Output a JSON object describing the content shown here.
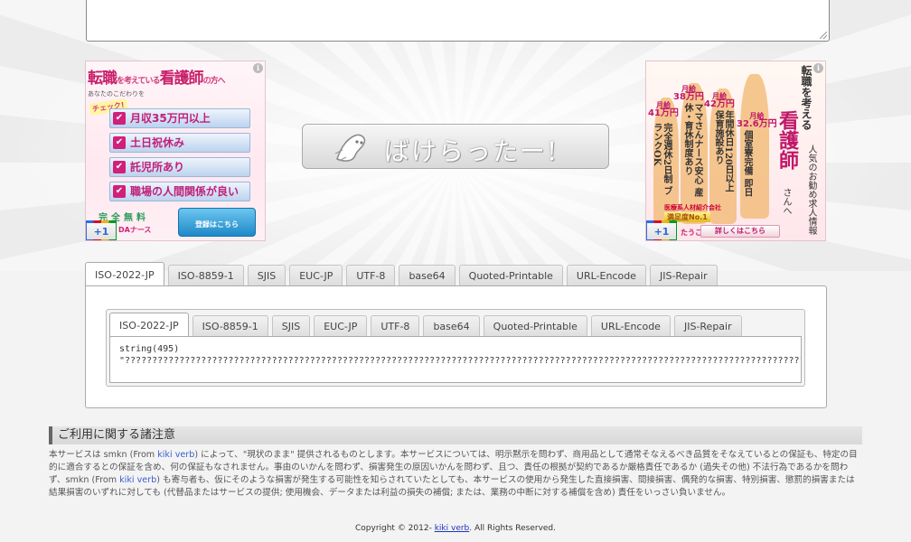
{
  "colors": {
    "background": "#f3f3f3",
    "accent_link": "#3a5fcd",
    "ad_pink": "#c0186a"
  },
  "ad_left": {
    "headline_a": "転職",
    "headline_b": "を考えている",
    "headline_c": "看護師",
    "headline_d": "の方へ",
    "sub": "あなたのこだわりを",
    "check": "チェック!",
    "options": [
      "月収35万円以上",
      "土日祝休み",
      "託児所あり",
      "職場の人間関係が良い"
    ],
    "free": "完全無料",
    "brand": "DAナース",
    "cta_main": "登録",
    "cta_small": "はこちら",
    "plus_one": "+1",
    "info_icon": "i"
  },
  "ad_right": {
    "title": "転職を考える",
    "big": "看護師",
    "sub": "人気のお勧め求人情報",
    "suffix": "さんへ",
    "pays": [
      {
        "label": "月給",
        "amount": "41万円"
      },
      {
        "label": "月給",
        "amount": "38万円"
      },
      {
        "label": "月給",
        "amount": "42万円"
      },
      {
        "label": "月給",
        "amount": "32.6万円"
      }
    ],
    "col1": "完全週休2日制 ブランクOK",
    "col2": "ママさんナース安心 産休・育休制度あり",
    "col3": "年間休日120日以上 保育施設あり",
    "col4": "個室寮完備 即日",
    "badge_small": "医療系人材紹介会社",
    "badge_main": "満足度No.1",
    "brand": "たうこ",
    "cta": "詳しくはこちら",
    "plus_one": "+1",
    "info_icon": "i"
  },
  "logo": {
    "text": "ばけらったー!"
  },
  "outer_tabs": [
    "ISO-2022-JP",
    "ISO-8859-1",
    "SJIS",
    "EUC-JP",
    "UTF-8",
    "base64",
    "Quoted-Printable",
    "URL-Encode",
    "JIS-Repair"
  ],
  "inner_tabs": [
    "ISO-2022-JP",
    "ISO-8859-1",
    "SJIS",
    "EUC-JP",
    "UTF-8",
    "base64",
    "Quoted-Printable",
    "URL-Encode",
    "JIS-Repair"
  ],
  "result": {
    "line1": "string(495)",
    "line2": "\"????????????????????????????????????????????????????????????????????????????????????????????????????????????????????????????????????????????????????????????????????????????????????????????????"
  },
  "disclaimer": {
    "title": "ご利用に関する諸注意",
    "p_before_link1": "本サービスは smkn (From ",
    "link1": "kiki verb",
    "p_after_link1": ") によって、\"現状のまま\" 提供されるものとします。本サービスについては、明示黙示を問わず、商用品として通常そなえるべき品質をそなえているとの保証も、特定の目的に適合するとの保証を含め、何の保証もなされません。事由のいかんを問わず、損害発生の原因いかんを問わず、且つ、責任の根拠が契約であるか厳格責任であるか (過失その他) 不法行為であるかを問わず、smkn (From ",
    "link2": "kiki verb",
    "p_after_link2": ") も寄与者も、仮にそのような損害が発生する可能性を知らされていたとしても、本サービスの使用から発生した直接損害、間接損害、偶発的な損害、特別損害、懲罰的損害または結果損害のいずれに対しても (代替品またはサービスの提供; 使用機会、データまたは利益の損失の補償; または、業務の中断に対する補償を含め) 責任をいっさい負いません。"
  },
  "footer": {
    "before": "Copyright © 2012- ",
    "link": "kiki verb",
    "after": ". All Rights Reserved."
  }
}
